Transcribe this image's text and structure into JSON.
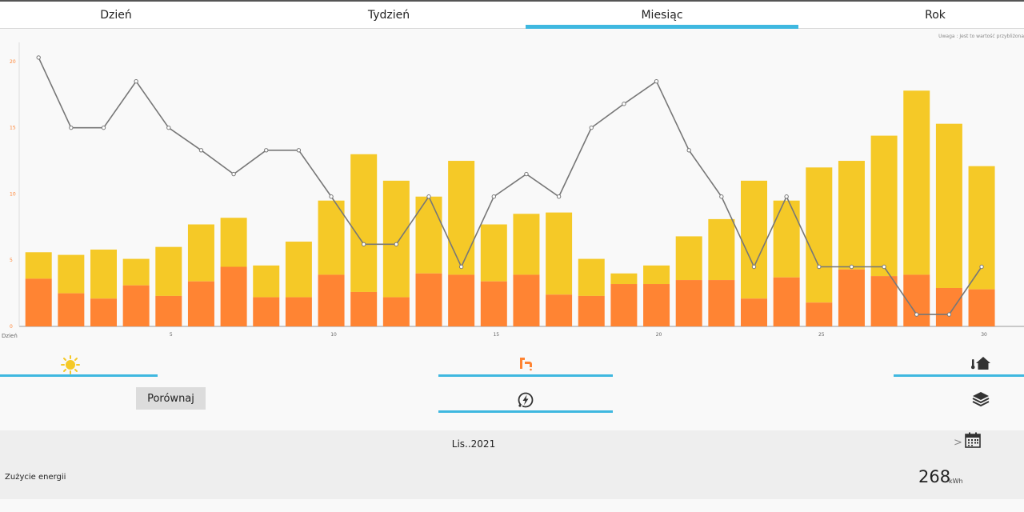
{
  "tabs": [
    {
      "label": "Dzień",
      "active": false
    },
    {
      "label": "Tydzień",
      "active": false
    },
    {
      "label": "Miesiąc",
      "active": true
    },
    {
      "label": "Rok",
      "active": false
    }
  ],
  "note": "Uwaga : Jest to wartość przybliżona",
  "chart_data": {
    "type": "bar",
    "xlabel": "Dzień",
    "x": [
      1,
      2,
      3,
      4,
      5,
      6,
      7,
      8,
      9,
      10,
      11,
      12,
      13,
      14,
      15,
      16,
      17,
      18,
      19,
      20,
      21,
      22,
      23,
      24,
      25,
      26,
      27,
      28,
      29,
      30
    ],
    "xticks": [
      5,
      10,
      15,
      20,
      25,
      30
    ],
    "yticks": [
      0,
      5,
      10,
      15,
      20
    ],
    "ylim": [
      0,
      21.2
    ],
    "stacked": true,
    "series": [
      {
        "kind": "bar",
        "color": "#ff8433",
        "values": [
          3.6,
          2.5,
          2.1,
          3.1,
          2.3,
          3.4,
          4.5,
          2.2,
          2.2,
          3.9,
          2.6,
          2.2,
          4.0,
          3.9,
          3.4,
          3.9,
          2.4,
          2.3,
          3.2,
          3.2,
          3.5,
          3.5,
          2.1,
          3.7,
          1.8,
          4.3,
          3.8,
          3.9,
          2.9,
          2.8
        ]
      },
      {
        "kind": "bar",
        "color": "#f5c927",
        "values": [
          2.0,
          2.9,
          3.7,
          2.0,
          3.7,
          4.3,
          3.7,
          2.4,
          4.2,
          5.6,
          10.4,
          8.8,
          5.8,
          8.6,
          4.3,
          4.6,
          6.2,
          2.8,
          0.8,
          1.4,
          3.3,
          4.6,
          8.9,
          5.8,
          10.2,
          8.2,
          10.6,
          13.9,
          12.4,
          9.3
        ]
      },
      {
        "kind": "line",
        "color": "#777777",
        "values": [
          20.3,
          15.0,
          15.0,
          18.5,
          15.0,
          13.3,
          11.5,
          13.3,
          13.3,
          9.8,
          6.2,
          6.2,
          9.8,
          4.5,
          9.8,
          11.5,
          9.8,
          15.0,
          16.8,
          18.5,
          13.3,
          9.8,
          4.5,
          9.8,
          4.5,
          4.5,
          4.5,
          0.9,
          0.9,
          4.5
        ]
      }
    ]
  },
  "icons": {
    "sun": "sun-icon",
    "faucet": "faucet-icon",
    "home": "home-thermometer-icon",
    "energy": "energy-icon",
    "layers": "layers-icon",
    "calendar": "calendar-icon"
  },
  "compare_label": "Porównaj",
  "period": {
    "label": "Lis..2021",
    "next": ">"
  },
  "usage": {
    "label": "Zużycie energii",
    "value": "268",
    "unit": "kWh"
  }
}
